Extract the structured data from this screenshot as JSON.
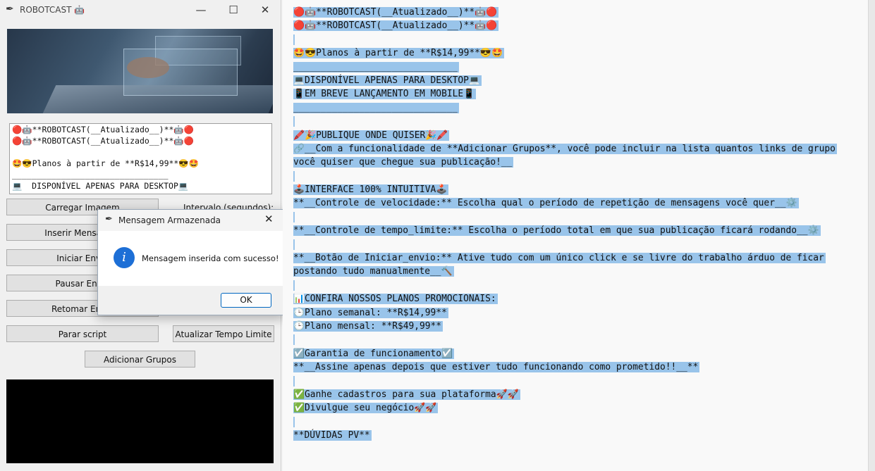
{
  "app": {
    "title": "ROBOTCAST 🤖",
    "app_icon": "feather-icon",
    "window_controls": {
      "minimize": "—",
      "maximize": "☐",
      "close": "✕"
    },
    "preview_lines": [
      "🔴🤖**ROBOTCAST(__Atualizado__)**🤖🔴",
      "🔴🤖**ROBOTCAST(__Atualizado__)**🤖🔴",
      "",
      "🤩😎Planos à partir de **R$14,99**😎🤩",
      "________________________________",
      "💻  DISPONÍVEL APENAS PARA DESKTOP💻"
    ],
    "buttons": {
      "load_image": "Carregar Imagem",
      "insert_message": "Inserir Mensagem",
      "start_send": "Iniciar Envio",
      "pause_send": "Pausar Envio",
      "resume_send": "Retomar Envio",
      "stop_script": "Parar script",
      "update_time_limit": "Atualizar Tempo Limite",
      "add_groups": "Adicionar Grupos"
    },
    "interval_label": "Intervalo (segundos):"
  },
  "dialog": {
    "title": "Mensagem Armazenada",
    "close": "✕",
    "message": "Mensagem inserida com sucesso!",
    "icon_glyph": "i",
    "ok_label": "OK"
  },
  "editor": {
    "selection_color": "#99c4ea",
    "lines": [
      "🔴🤖**ROBOTCAST(__Atualizado__)**🤖🔴",
      "🔴🤖**ROBOTCAST(__Atualizado__)**🤖🔴",
      "",
      "🤩😎Planos à partir de **R$14,99**😎🤩",
      "______________________________",
      "💻DISPONÍVEL APENAS PARA DESKTOP💻",
      "📱EM BREVE LANÇAMENTO EM MOBILE📱",
      "______________________________",
      "",
      "🖍️🎉PUBLIQUE ONDE QUISER🎉🖍️",
      "🔗__Com a funcionalidade de **Adicionar Grupos**, você pode incluir na lista quantos links de grupo",
      "você quiser que chegue sua publicação!__",
      "",
      "🕹️INTERFACE 100% INTUITIVA🕹️",
      "**__Controle de velocidade:** Escolha qual o período de repetição de mensagens você quer__⚙️",
      "",
      "**__Controle de tempo_limite:** Escolha o período total em que sua publicação ficará rodando__⚙️",
      "",
      "**__Botão de Iniciar_envio:** Ative tudo com um único click e se livre do trabalho árduo de ficar",
      "postando tudo manualmente__🔨",
      "",
      "📊CONFIRA NOSSOS PLANOS PROMOCIONAIS:",
      "🕒Plano semanal: **R$14,99**",
      "🕒Plano mensal: **R$49,99**",
      "",
      "☑️Garantia de funcionamento☑️",
      "**__Assine apenas depois que estiver tudo funcionando como prometido!!__**",
      "",
      "✅Ganhe cadastros para sua plataforma🚀🚀",
      "✅Divulgue seu negócio🚀🚀",
      "",
      "**DÚVIDAS PV**"
    ]
  }
}
